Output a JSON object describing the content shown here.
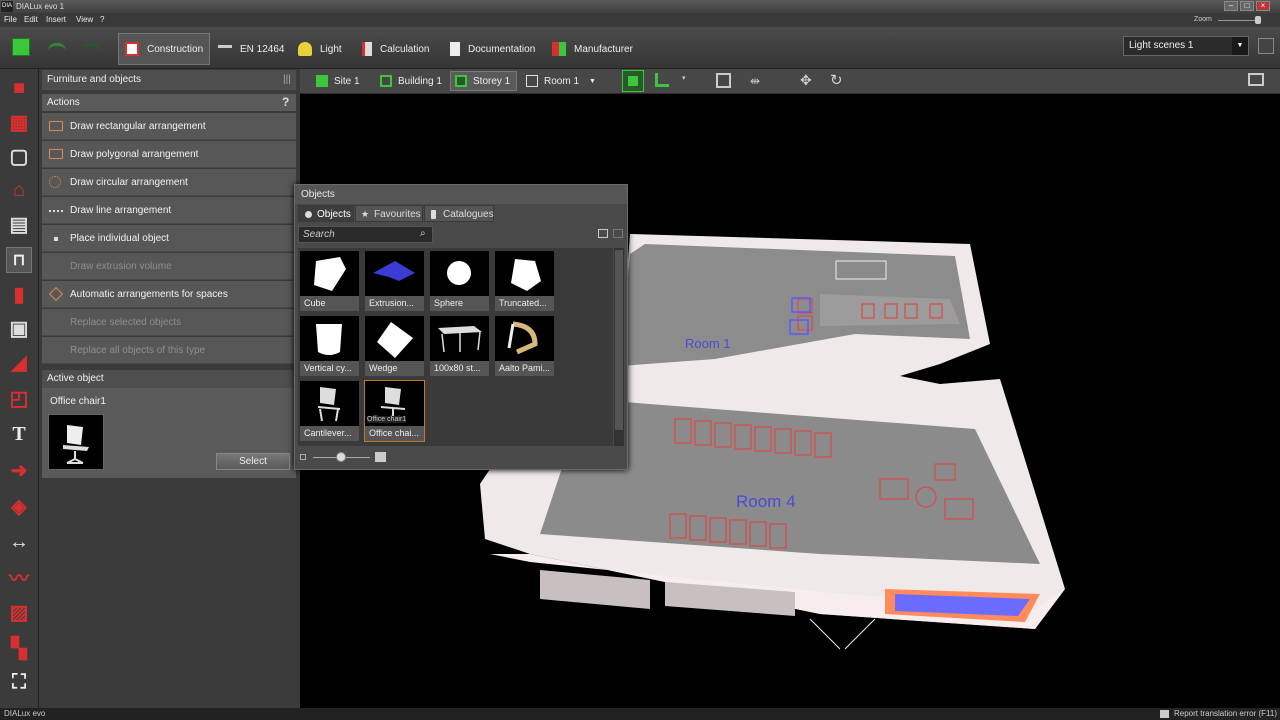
{
  "app": {
    "title": "DIALux evo 1",
    "icon_text": "DIA"
  },
  "menu": {
    "items": [
      "File",
      "Edit",
      "Insert",
      "View",
      "?"
    ],
    "zoom_label": "Zoom"
  },
  "toolbar": {
    "tabs": [
      {
        "label": "Construction",
        "icon": "construction-icon"
      },
      {
        "label": "EN 12464",
        "icon": "table-icon"
      },
      {
        "label": "Light",
        "icon": "lamp-icon"
      },
      {
        "label": "Calculation",
        "icon": "calculation-icon"
      },
      {
        "label": "Documentation",
        "icon": "document-icon"
      },
      {
        "label": "Manufacturer",
        "icon": "manufacturer-icon"
      }
    ],
    "light_scenes": "Light scenes 1",
    "colors": {
      "accent_green": "#3cc63c",
      "accent_red": "#d83030"
    }
  },
  "view_toolbar": {
    "site": "Site 1",
    "building": "Building 1",
    "storey": "Storey 1",
    "room": "Room 1"
  },
  "panel": {
    "title": "Furniture and objects",
    "actions_header": "Actions",
    "help": "?",
    "actions": [
      {
        "label": "Draw rectangular arrangement",
        "enabled": true
      },
      {
        "label": "Draw polygonal arrangement",
        "enabled": true
      },
      {
        "label": "Draw circular arrangement",
        "enabled": true
      },
      {
        "label": "Draw line arrangement",
        "enabled": true
      },
      {
        "label": "Place individual object",
        "enabled": true
      },
      {
        "label": "Draw extrusion volume",
        "enabled": false
      },
      {
        "label": "Automatic arrangements for spaces",
        "enabled": true
      },
      {
        "label": "Replace selected objects",
        "enabled": false
      },
      {
        "label": "Replace all objects of this type",
        "enabled": false
      }
    ],
    "active_header": "Active object",
    "active_name": "Office chair1",
    "select_button": "Select"
  },
  "objects": {
    "title": "Objects",
    "tabs": [
      "Objects",
      "Favourites",
      "Catalogues"
    ],
    "search_placeholder": "Search",
    "items": [
      "Cube",
      "Extrusion...",
      "Sphere",
      "Truncated...",
      "Vertical cy...",
      "Wedge",
      "100x80 st...",
      "Aalto Pami...",
      "Cantilever...",
      "Office chai..."
    ],
    "tooltip": "Office chair1"
  },
  "viewport": {
    "room_labels": [
      "Room 1",
      "Room 4"
    ]
  },
  "status": {
    "left": "DIALux evo",
    "right": "Report translation error (F11)"
  }
}
